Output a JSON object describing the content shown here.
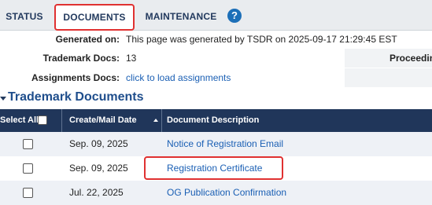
{
  "tabs": {
    "status": "STATUS",
    "documents": "DOCUMENTS",
    "maintenance": "MAINTENANCE",
    "help_glyph": "?"
  },
  "info": {
    "generated_label": "Generated on:",
    "generated_value": "This page was generated by TSDR on 2025-09-17 21:29:45 EST",
    "trademark_docs_label": "Trademark Docs:",
    "trademark_docs_value": "13",
    "proceedings_label": "Proceedin",
    "assignments_label": "Assignments Docs:",
    "assignments_value": "click to load assignments"
  },
  "section": {
    "title": "Trademark Documents"
  },
  "table": {
    "headers": {
      "select_all": "Select All",
      "date": "Create/Mail Date",
      "description": "Document Description"
    },
    "rows": [
      {
        "date": "Sep. 09, 2025",
        "description": "Notice of Registration Email"
      },
      {
        "date": "Sep. 09, 2025",
        "description": "Registration Certificate"
      },
      {
        "date": "Jul. 22, 2025",
        "description": "OG Publication Confirmation"
      }
    ]
  },
  "colors": {
    "header_bg": "#20365a",
    "link": "#1a5fb4",
    "highlight": "#e03131",
    "help_icon": "#1c6fb8"
  },
  "icons": {
    "help": "question-circle-icon",
    "collapse": "caret-down-icon",
    "sort": "sort-ascending-icon"
  }
}
